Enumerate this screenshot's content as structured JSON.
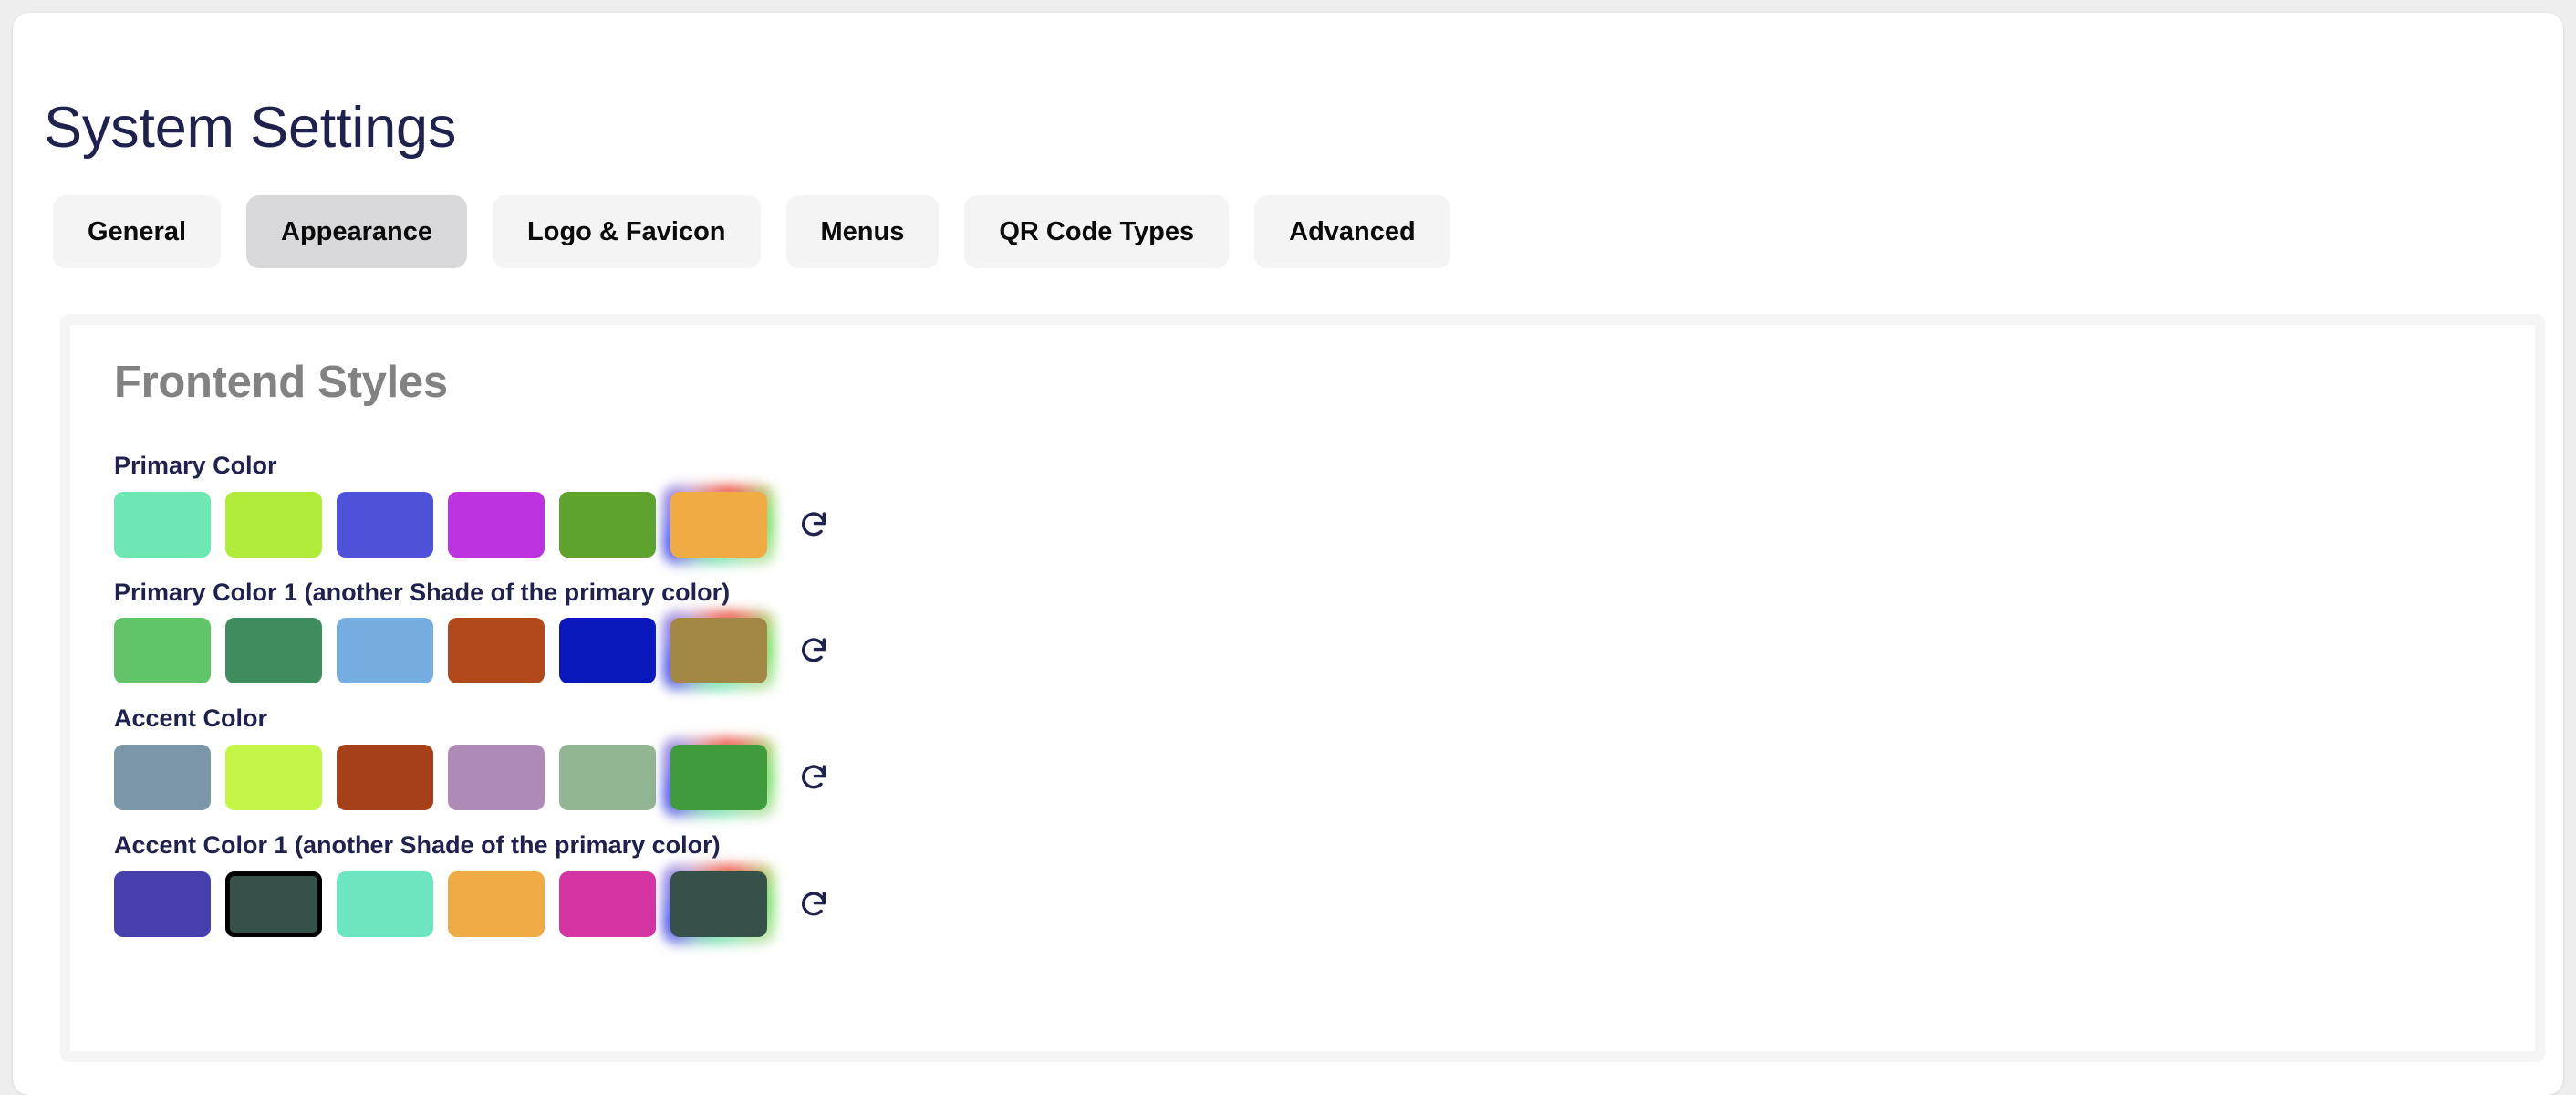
{
  "page": {
    "title": "System Settings",
    "title_color": "#20224e",
    "background": "#eeeeef"
  },
  "tabs": [
    {
      "label": "General",
      "active": false
    },
    {
      "label": "Appearance",
      "active": true
    },
    {
      "label": "Logo & Favicon",
      "active": false
    },
    {
      "label": "Menus",
      "active": false
    },
    {
      "label": "QR Code Types",
      "active": false
    },
    {
      "label": "Advanced",
      "active": false
    }
  ],
  "panel": {
    "heading": "Frontend Styles",
    "heading_color": "#828282"
  },
  "color_rows": [
    {
      "label": "Primary Color",
      "reset_icon": "refresh-icon",
      "reset_label": "Reset",
      "swatches": [
        {
          "color": "#6fe7b2",
          "selected": false
        },
        {
          "color": "#b2ec3a",
          "selected": false
        },
        {
          "color": "#4f53d9",
          "selected": false
        },
        {
          "color": "#bd33e0",
          "selected": false
        },
        {
          "color": "#5ea32e",
          "selected": false
        }
      ],
      "picker": {
        "color": "#f0ab44",
        "name": "primary-color-picker"
      }
    },
    {
      "label": "Primary Color 1 (another Shade of the primary color)",
      "reset_icon": "refresh-icon",
      "reset_label": "Reset",
      "swatches": [
        {
          "color": "#62c469",
          "selected": false
        },
        {
          "color": "#3f8c5f",
          "selected": false
        },
        {
          "color": "#77aee2",
          "selected": false
        },
        {
          "color": "#b2491b",
          "selected": false
        },
        {
          "color": "#0917bb",
          "selected": false
        }
      ],
      "picker": {
        "color": "#a38845",
        "name": "primary-color-1-picker"
      }
    },
    {
      "label": "Accent Color",
      "reset_icon": "refresh-icon",
      "reset_label": "Reset",
      "swatches": [
        {
          "color": "#7b96a7",
          "selected": false
        },
        {
          "color": "#c4f446",
          "selected": false
        },
        {
          "color": "#a6401a",
          "selected": false
        },
        {
          "color": "#ae8bb6",
          "selected": false
        },
        {
          "color": "#92b691",
          "selected": false
        }
      ],
      "picker": {
        "color": "#3f9b3b",
        "name": "accent-color-picker"
      }
    },
    {
      "label": "Accent Color 1 (another Shade of the primary color)",
      "reset_icon": "refresh-icon",
      "reset_label": "Reset",
      "swatches": [
        {
          "color": "#4640ad",
          "selected": false
        },
        {
          "color": "#36514a",
          "selected": true
        },
        {
          "color": "#6ee5c1",
          "selected": false
        },
        {
          "color": "#efab45",
          "selected": false
        },
        {
          "color": "#d534a3",
          "selected": false
        }
      ],
      "picker": {
        "color": "#36514a",
        "name": "accent-color-1-picker"
      }
    }
  ]
}
